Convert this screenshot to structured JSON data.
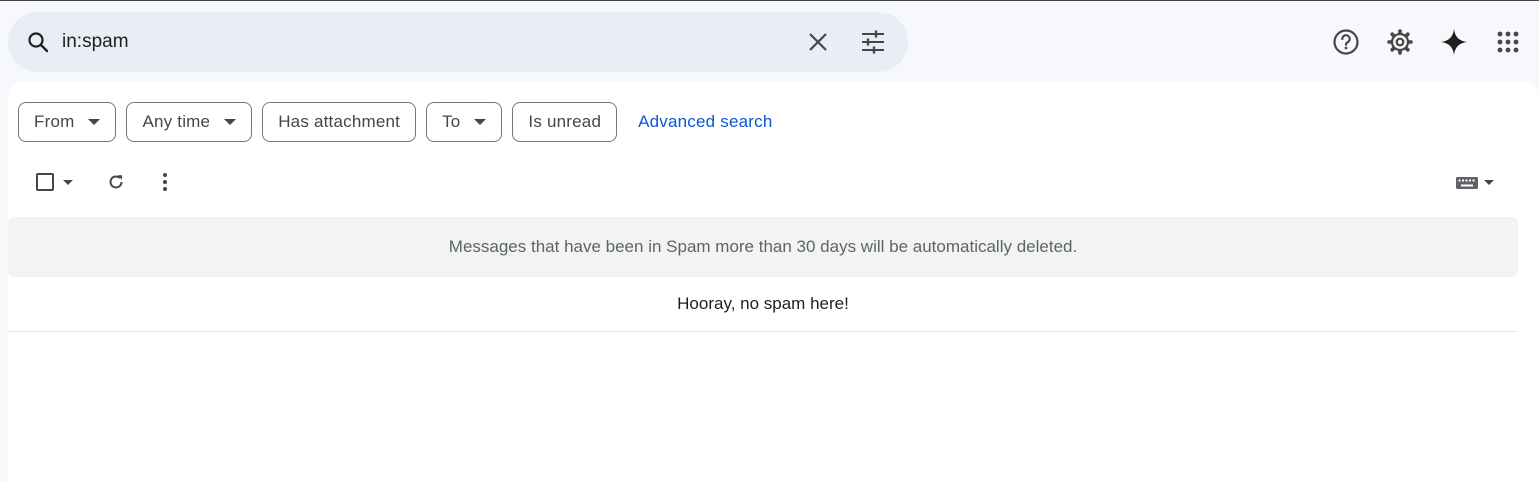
{
  "search": {
    "value": "in:spam",
    "icons": {
      "search": "search-icon",
      "clear": "close-icon",
      "options": "tune-icon"
    }
  },
  "header_actions": {
    "icons": [
      "help-icon",
      "gear-icon",
      "sparkle-icon",
      "apps-grid-icon"
    ]
  },
  "filter_chips": [
    {
      "label": "From",
      "has_dropdown": true
    },
    {
      "label": "Any time",
      "has_dropdown": true
    },
    {
      "label": "Has attachment",
      "has_dropdown": false
    },
    {
      "label": "To",
      "has_dropdown": true
    },
    {
      "label": "Is unread",
      "has_dropdown": false
    }
  ],
  "advanced_search_label": "Advanced search",
  "toolbar": {
    "icons": [
      "checkbox-icon",
      "refresh-icon",
      "more-vert-icon",
      "keyboard-icon"
    ]
  },
  "notice_text": "Messages that have been in Spam more than 30 days will be automatically deleted.",
  "empty_text": "Hooray, no spam here!",
  "colors": {
    "background": "#f6f8fc",
    "search_bg": "#e9eef6",
    "link": "#0b57d0",
    "notice_bg": "#f2f4f3"
  }
}
